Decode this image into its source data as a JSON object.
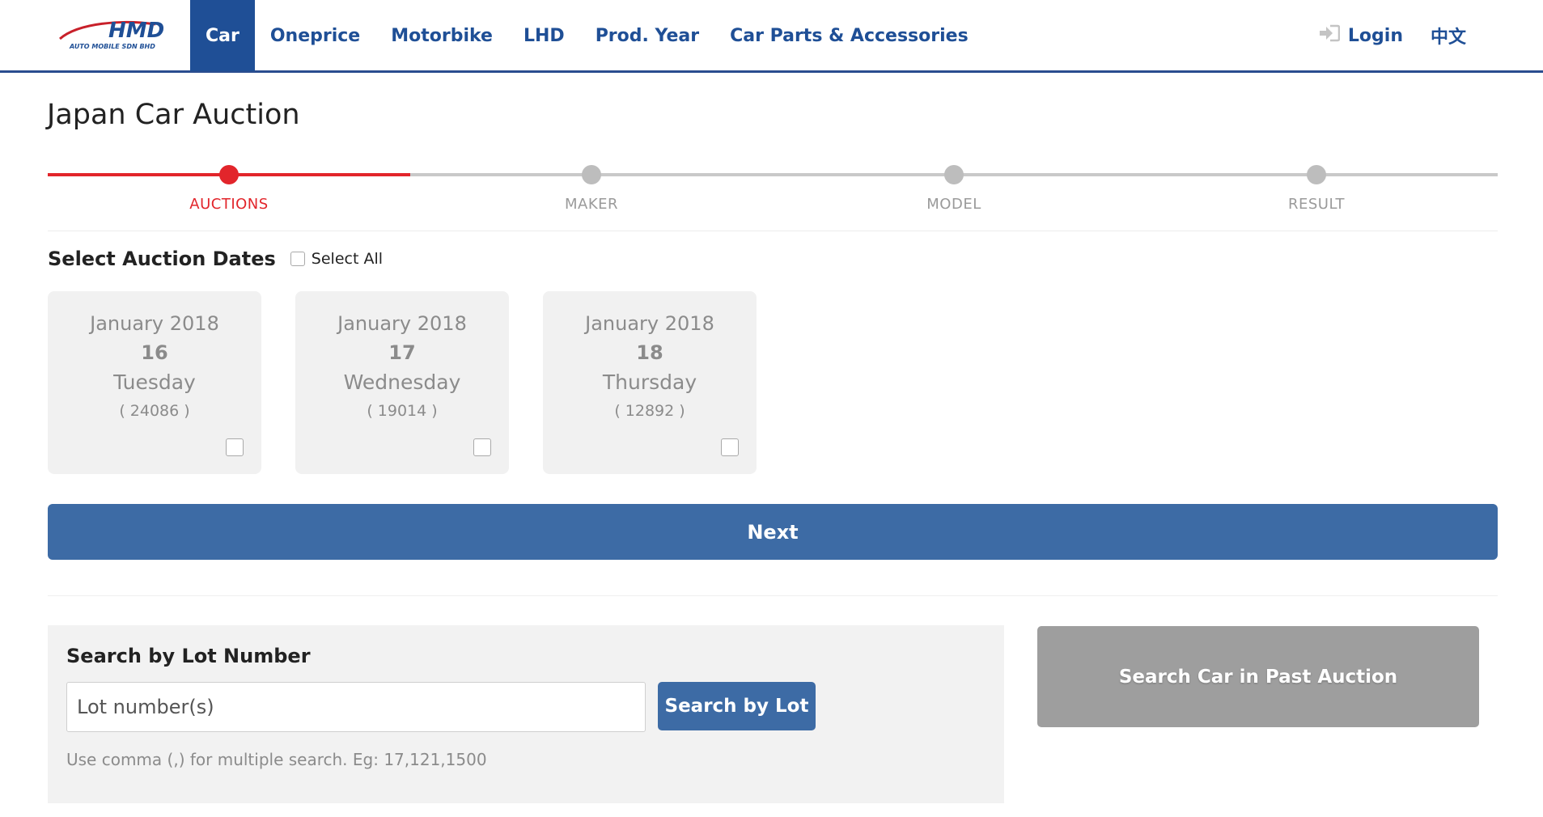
{
  "header": {
    "logo_text": "HMD",
    "logo_subtext": "AUTO MOBILE SDN BHD",
    "nav": [
      {
        "label": "Car",
        "active": true
      },
      {
        "label": "Oneprice",
        "active": false
      },
      {
        "label": "Motorbike",
        "active": false
      },
      {
        "label": "LHD",
        "active": false
      },
      {
        "label": "Prod. Year",
        "active": false
      },
      {
        "label": "Car Parts & Accessories",
        "active": false
      }
    ],
    "login_label": "Login",
    "login_icon": "sign-in-icon",
    "lang_label": "中文"
  },
  "page": {
    "title": "Japan Car Auction"
  },
  "stepper": {
    "active_index": 0,
    "steps": [
      "AUCTIONS",
      "MAKER",
      "MODEL",
      "RESULT"
    ]
  },
  "auction_dates": {
    "title": "Select Auction Dates",
    "select_all_label": "Select All",
    "dates": [
      {
        "month": "January 2018",
        "day": "16",
        "weekday": "Tuesday",
        "count": "( 24086 )"
      },
      {
        "month": "January 2018",
        "day": "17",
        "weekday": "Wednesday",
        "count": "( 19014 )"
      },
      {
        "month": "January 2018",
        "day": "18",
        "weekday": "Thursday",
        "count": "( 12892 )"
      }
    ]
  },
  "next_label": "Next",
  "lot_search": {
    "title": "Search by Lot Number",
    "placeholder": "Lot number(s)",
    "button_label": "Search by Lot",
    "hint": "Use comma (,) for multiple search. Eg: 17,121,1500"
  },
  "past_auction_label": "Search Car in Past Auction",
  "colors": {
    "brand_blue": "#1f4f96",
    "button_blue": "#3d6ba5",
    "active_red": "#e2252b",
    "inactive_gray": "#bdbdbd"
  }
}
